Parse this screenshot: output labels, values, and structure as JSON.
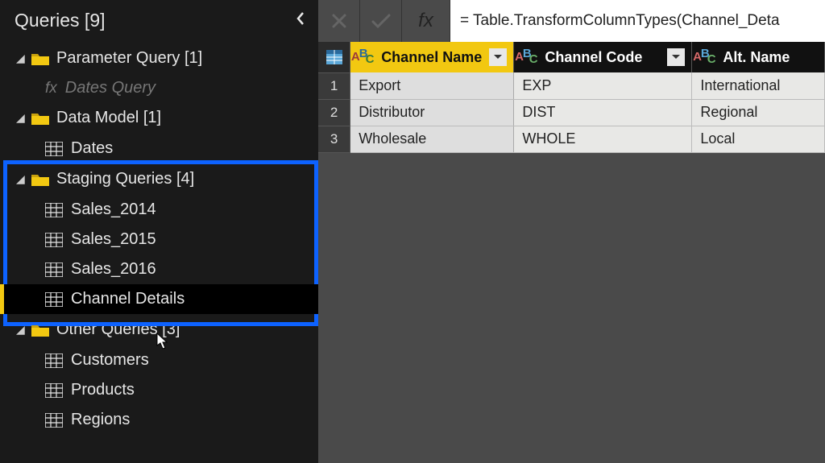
{
  "sidebar": {
    "title": "Queries [9]",
    "groups": [
      {
        "label": "Parameter Query [1]",
        "items": [
          {
            "type": "fx",
            "label": "Dates Query"
          }
        ]
      },
      {
        "label": "Data Model [1]",
        "items": [
          {
            "type": "table",
            "label": "Dates"
          }
        ]
      },
      {
        "label": "Staging Queries [4]",
        "highlighted": true,
        "items": [
          {
            "type": "table",
            "label": "Sales_2014"
          },
          {
            "type": "table",
            "label": "Sales_2015"
          },
          {
            "type": "table",
            "label": "Sales_2016"
          },
          {
            "type": "table",
            "label": "Channel Details",
            "selected": true
          }
        ]
      },
      {
        "label": "Other Queries [3]",
        "items": [
          {
            "type": "table",
            "label": "Customers"
          },
          {
            "type": "table",
            "label": "Products"
          },
          {
            "type": "table",
            "label": "Regions"
          }
        ]
      }
    ]
  },
  "formula_bar": {
    "fx": "fx",
    "value": "= Table.TransformColumnTypes(Channel_Deta"
  },
  "table": {
    "columns": [
      {
        "name": "Channel Name",
        "selected": true
      },
      {
        "name": "Channel Code",
        "selected": false
      },
      {
        "name": "Alt. Name",
        "selected": false
      }
    ],
    "rows": [
      [
        "Export",
        "EXP",
        "International"
      ],
      [
        "Distributor",
        "DIST",
        "Regional"
      ],
      [
        "Wholesale",
        "WHOLE",
        "Local"
      ]
    ]
  }
}
